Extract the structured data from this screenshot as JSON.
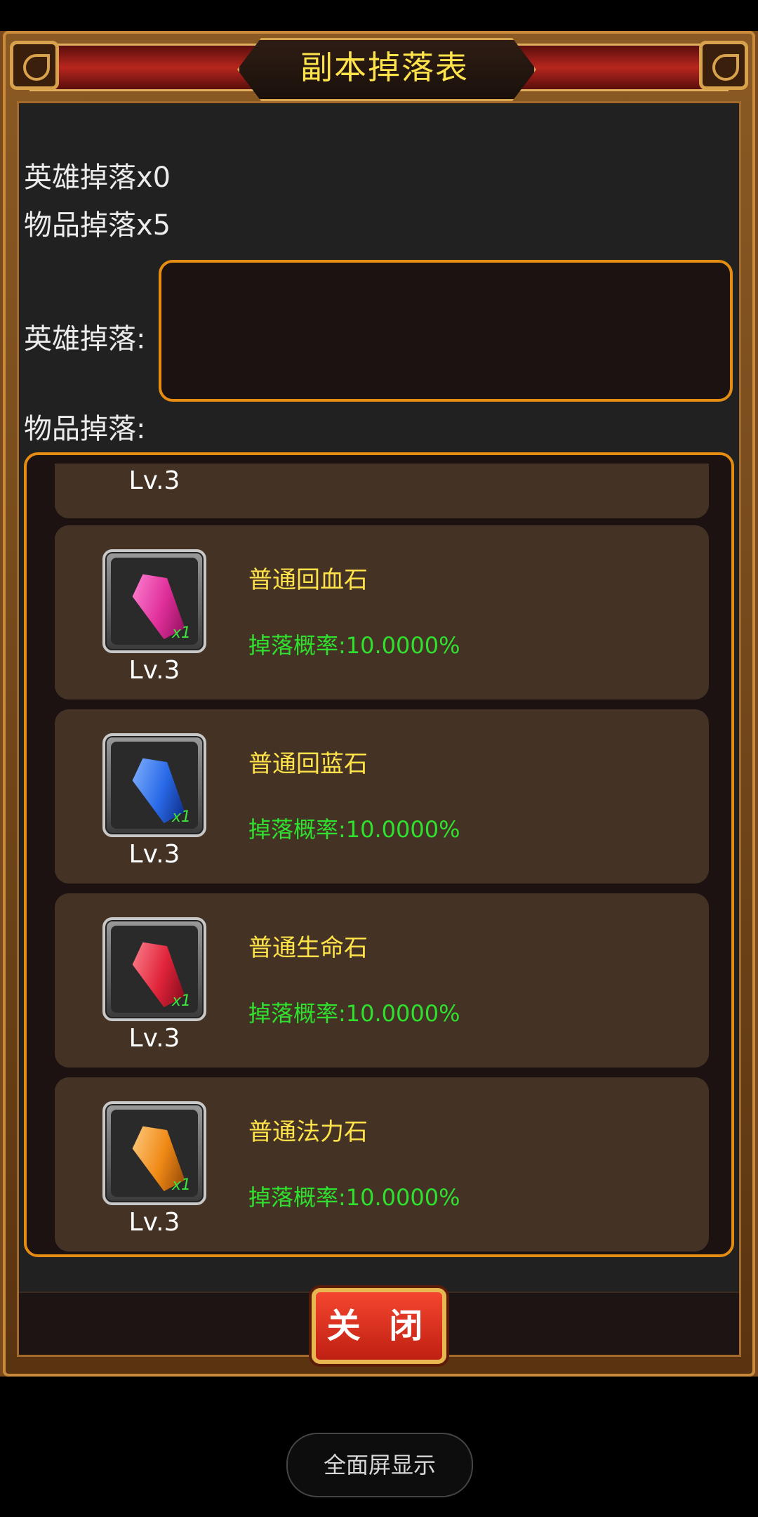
{
  "title": "副本掉落表",
  "summary": {
    "hero_count": "英雄掉落x0",
    "item_count": "物品掉落x5"
  },
  "labels": {
    "hero_drop": "英雄掉落:",
    "item_drop": "物品掉落:"
  },
  "items": [
    {
      "level": "Lv.3",
      "partial": true
    },
    {
      "name": "普通回血石",
      "rate": "掉落概率:10.0000%",
      "level": "Lv.3",
      "qty": "x1",
      "gem_color": "#e0309a"
    },
    {
      "name": "普通回蓝石",
      "rate": "掉落概率:10.0000%",
      "level": "Lv.3",
      "qty": "x1",
      "gem_color": "#2a6ae8"
    },
    {
      "name": "普通生命石",
      "rate": "掉落概率:10.0000%",
      "level": "Lv.3",
      "qty": "x1",
      "gem_color": "#e0243a"
    },
    {
      "name": "普通法力石",
      "rate": "掉落概率:10.0000%",
      "level": "Lv.3",
      "qty": "x1",
      "gem_color": "#f08a16"
    }
  ],
  "close_button": "关 闭",
  "fullscreen_pill": "全面屏显示"
}
